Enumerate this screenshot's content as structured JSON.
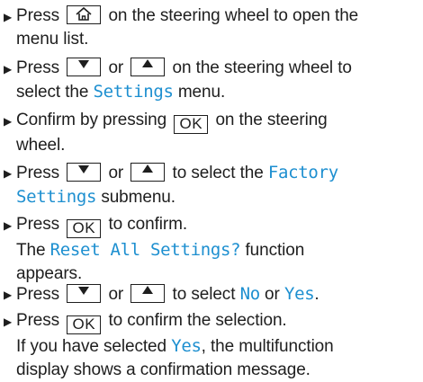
{
  "steps": [
    {
      "pre": "Press",
      "post": "on the steering wheel to open the",
      "line2": "menu list."
    },
    {
      "pre": "Press",
      "or": "or",
      "post": "on the steering wheel to",
      "line2_pre": "select the",
      "hl": "Settings",
      "line2_post": "menu."
    },
    {
      "line1": "Confirm by pressing",
      "post": "on the steering",
      "line2": "wheel."
    },
    {
      "pre": "Press",
      "or": "or",
      "post": "to select the",
      "hl1": "Factory",
      "hl2": "Settings",
      "line2_post": "submenu."
    },
    {
      "pre": "Press",
      "post": "to confirm.",
      "line2_pre": "The",
      "hl": "Reset All Settings?",
      "line2_post": "function",
      "line3": "appears."
    },
    {
      "pre": "Press",
      "or": "or",
      "post": "to select",
      "hl_no": "No",
      "or2": "or",
      "hl_yes": "Yes",
      "end": "."
    },
    {
      "pre": "Press",
      "post": "to confirm the selection.",
      "line2_pre": "If you have selected",
      "hl": "Yes",
      "line2_post": ", the multifunction",
      "line3": "display shows a confirmation message."
    }
  ],
  "keys": {
    "ok": "OK"
  },
  "icons": {
    "bullet": "triangle-bullet-icon",
    "home": "home-icon",
    "down": "down-arrow-icon",
    "up": "up-arrow-icon"
  },
  "colors": {
    "text": "#1e1e1e",
    "highlight": "#1d8fd0"
  }
}
